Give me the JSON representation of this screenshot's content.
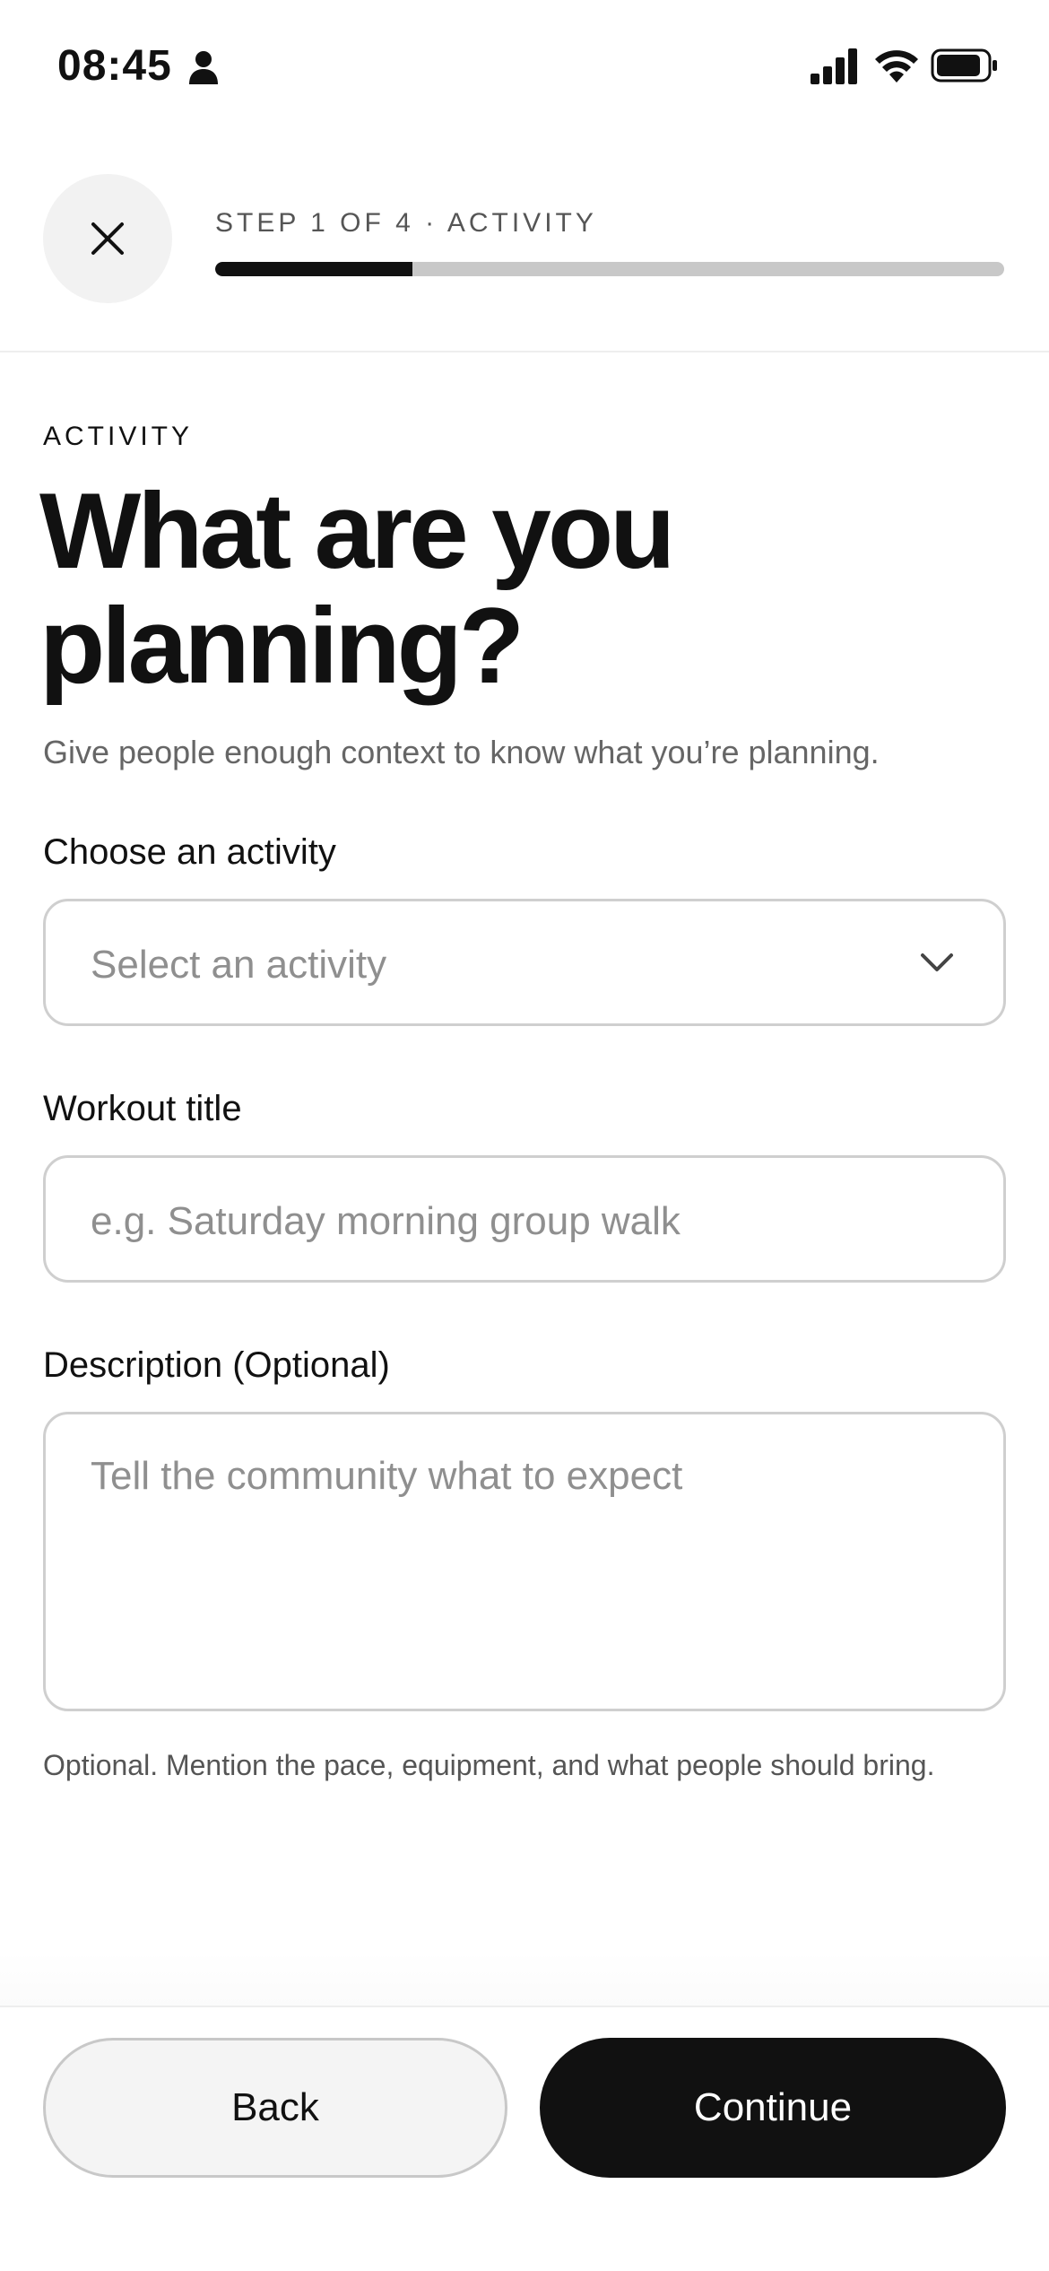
{
  "status_bar": {
    "time": "08:45"
  },
  "header": {
    "step_label": "STEP 1 OF 4 · ACTIVITY",
    "progress": 0.25
  },
  "content": {
    "eyebrow": "ACTIVITY",
    "title": "What are you planning?",
    "subtitle": "Give people enough context to know what you’re planning.",
    "activity_field": {
      "label": "Choose an activity",
      "placeholder": "Select an activity"
    },
    "title_field": {
      "label": "Workout title",
      "placeholder": "e.g. Saturday morning group walk"
    },
    "description_field": {
      "label": "Description (Optional)",
      "placeholder": "Tell the community what to expect",
      "helper": "Optional. Mention the pace, equipment, and what people should bring."
    }
  },
  "footer": {
    "back_label": "Back",
    "continue_label": "Continue"
  },
  "colors": {
    "primary": "#111111",
    "track": "#c8c8c8",
    "close_bg": "#f2f2f2"
  }
}
